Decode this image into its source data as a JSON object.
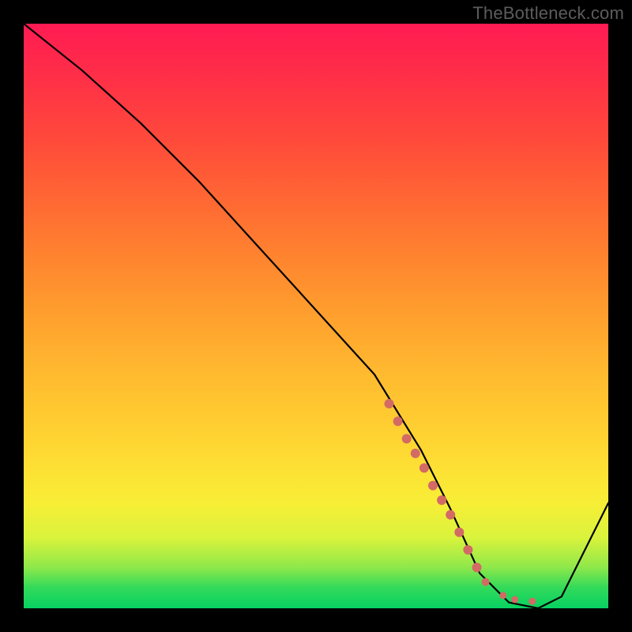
{
  "watermark": "TheBottleneck.com",
  "chart_data": {
    "type": "line",
    "title": "",
    "xlabel": "",
    "ylabel": "",
    "xlim": [
      0,
      100
    ],
    "ylim": [
      0,
      100
    ],
    "series": [
      {
        "name": "bottleneck-curve",
        "x": [
          0,
          10,
          20,
          30,
          40,
          50,
          60,
          68,
          73,
          78,
          83,
          88,
          92,
          100
        ],
        "values": [
          100,
          92,
          83,
          73,
          62,
          51,
          40,
          27,
          17,
          6,
          1,
          0,
          2,
          18
        ]
      }
    ],
    "markers": {
      "name": "highlight-dots",
      "color": "#d36a64",
      "points": [
        {
          "x": 62.5,
          "y": 35,
          "r": 6
        },
        {
          "x": 64,
          "y": 32,
          "r": 6
        },
        {
          "x": 65.5,
          "y": 29,
          "r": 6
        },
        {
          "x": 67,
          "y": 26.5,
          "r": 6
        },
        {
          "x": 68.5,
          "y": 24,
          "r": 6
        },
        {
          "x": 70,
          "y": 21,
          "r": 6
        },
        {
          "x": 71.5,
          "y": 18.5,
          "r": 6
        },
        {
          "x": 73,
          "y": 16,
          "r": 6
        },
        {
          "x": 74.5,
          "y": 13,
          "r": 6
        },
        {
          "x": 76,
          "y": 10,
          "r": 6
        },
        {
          "x": 77.5,
          "y": 7,
          "r": 6
        },
        {
          "x": 79,
          "y": 4.5,
          "r": 5
        },
        {
          "x": 82,
          "y": 2.2,
          "r": 4.5
        },
        {
          "x": 84,
          "y": 1.5,
          "r": 4.5
        },
        {
          "x": 87,
          "y": 1.2,
          "r": 4.5
        }
      ]
    }
  }
}
